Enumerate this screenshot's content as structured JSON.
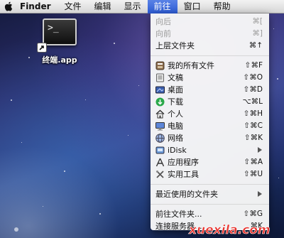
{
  "menubar": {
    "apple_icon": "apple-logo-icon",
    "app_name": "Finder",
    "menus": [
      "文件",
      "编辑",
      "显示",
      "前往",
      "窗口",
      "帮助"
    ],
    "active_menu": "前往",
    "active_color": "#3b6ee0"
  },
  "desktop": {
    "icon_label": "终端.app",
    "terminal_prompt": ">_"
  },
  "go_menu": {
    "items": [
      {
        "label": "向后",
        "shortcut": "⌘[",
        "enabled": false
      },
      {
        "label": "向前",
        "shortcut": "⌘]",
        "enabled": false
      },
      {
        "label": "上层文件夹",
        "shortcut": "⌘↑",
        "enabled": true
      },
      {
        "label": "我的所有文件",
        "shortcut": "⇧⌘F",
        "icon": "all-my-files-icon"
      },
      {
        "label": "文稿",
        "shortcut": "⇧⌘O",
        "icon": "documents-icon"
      },
      {
        "label": "桌面",
        "shortcut": "⇧⌘D",
        "icon": "desktop-icon"
      },
      {
        "label": "下载",
        "shortcut": "⌥⌘L",
        "icon": "downloads-icon"
      },
      {
        "label": "个人",
        "shortcut": "⇧⌘H",
        "icon": "home-icon"
      },
      {
        "label": "电脑",
        "shortcut": "⇧⌘C",
        "icon": "computer-icon"
      },
      {
        "label": "网络",
        "shortcut": "⇧⌘K",
        "icon": "network-icon"
      },
      {
        "label": "iDisk",
        "submenu": true,
        "icon": "idisk-icon"
      },
      {
        "label": "应用程序",
        "shortcut": "⇧⌘A",
        "icon": "applications-icon"
      },
      {
        "label": "实用工具",
        "shortcut": "⇧⌘U",
        "icon": "utilities-icon"
      },
      {
        "label": "最近使用的文件夹",
        "submenu": true
      },
      {
        "label": "前往文件夹...",
        "shortcut": "⇧⌘G"
      },
      {
        "label": "连接服务器...",
        "shortcut": "⌘K"
      }
    ]
  },
  "watermark": {
    "text": "xuexila.com"
  }
}
